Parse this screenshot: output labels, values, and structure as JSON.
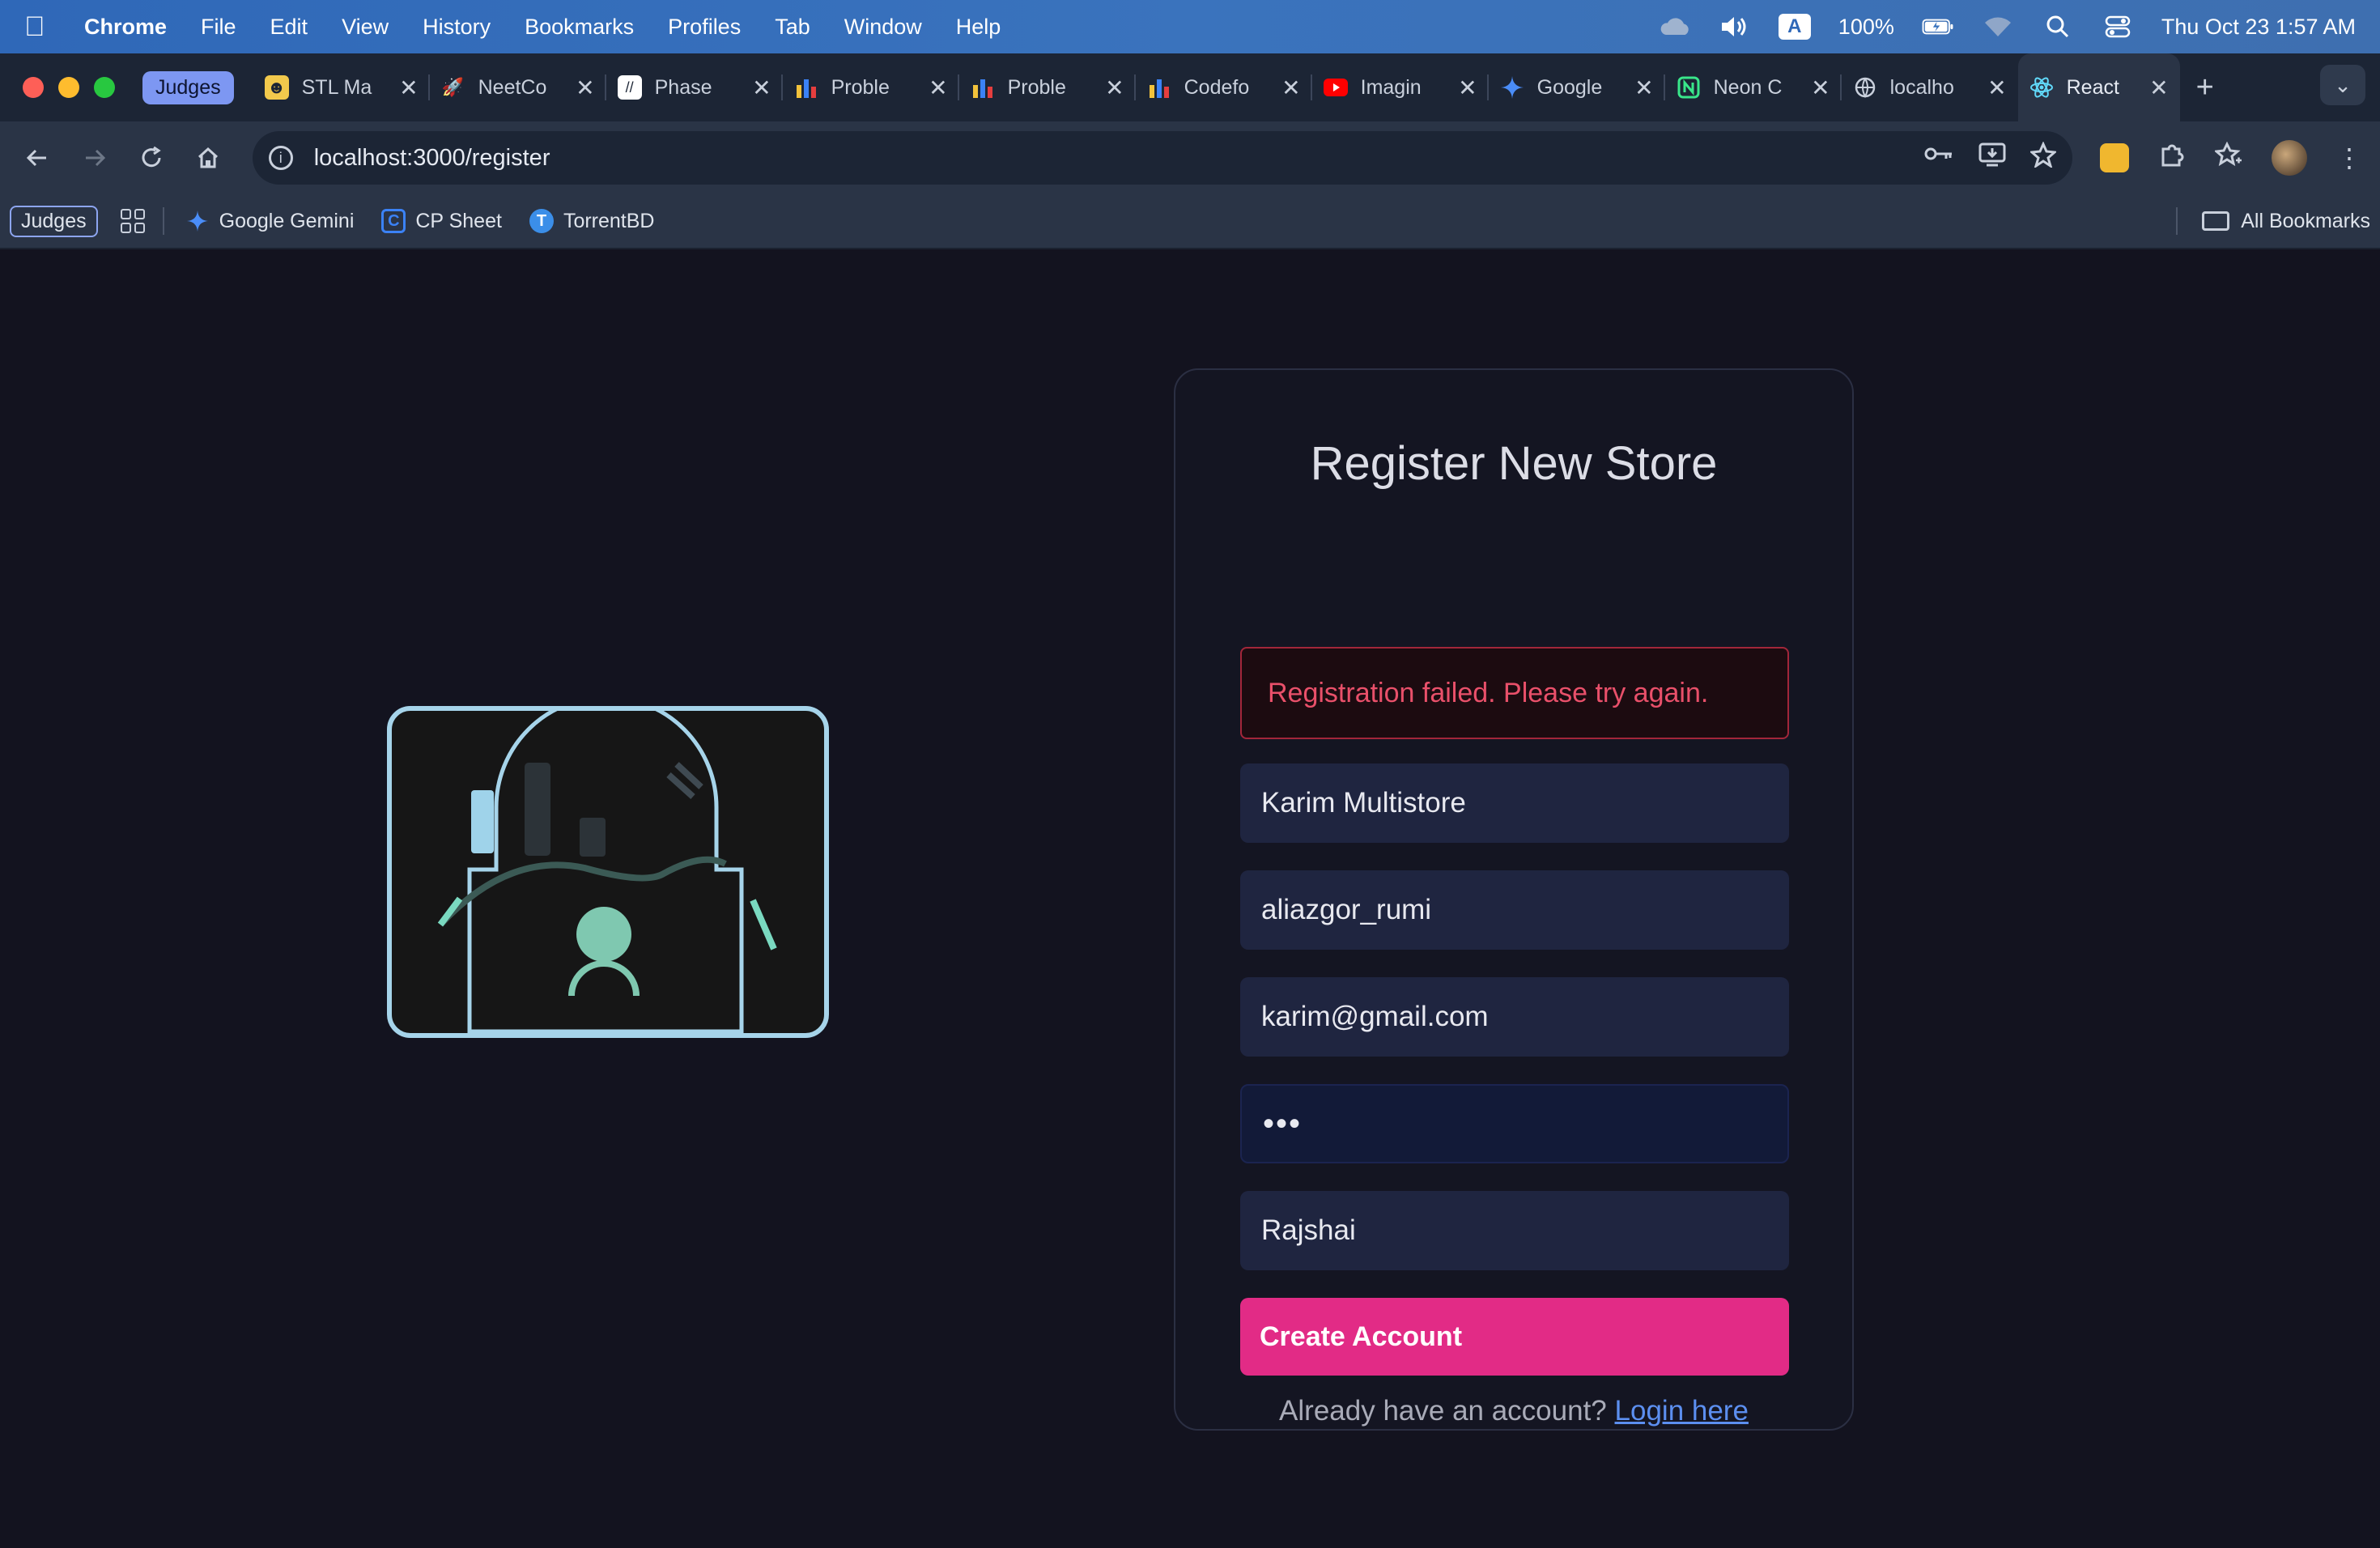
{
  "menubar": {
    "app_name": "Chrome",
    "items": [
      "File",
      "Edit",
      "View",
      "History",
      "Bookmarks",
      "Profiles",
      "Tab",
      "Window",
      "Help"
    ],
    "input_badge": "A",
    "battery": "100%",
    "clock": "Thu Oct 23  1:57 AM"
  },
  "tabstrip": {
    "group_label": "Judges",
    "tabs": [
      {
        "label": "STL Ma",
        "icon": "stl-icon",
        "color": "#f2c94c"
      },
      {
        "label": "NeetCo",
        "icon": "rocket-icon",
        "color": "#ff7a59"
      },
      {
        "label": "Phase",
        "icon": "phase-icon",
        "color": "#ffffff"
      },
      {
        "label": "Proble",
        "icon": "bar-chart-icon",
        "color": "#f2a93b"
      },
      {
        "label": "Proble",
        "icon": "bar-chart-icon",
        "color": "#f2a93b"
      },
      {
        "label": "Codefo",
        "icon": "bar-chart-icon",
        "color": "#f2a93b"
      },
      {
        "label": "Imagin",
        "icon": "youtube-icon",
        "color": "#ff0000"
      },
      {
        "label": "Google",
        "icon": "gemini-icon",
        "color": "#4a8df8"
      },
      {
        "label": "Neon C",
        "icon": "neon-icon",
        "color": "#39e68a"
      },
      {
        "label": "localho",
        "icon": "globe-icon",
        "color": "#c9d0dc"
      }
    ],
    "active_tab": {
      "label": "React A",
      "icon": "react-icon",
      "color": "#61dafb"
    }
  },
  "toolbar": {
    "url": "localhost:3000/register"
  },
  "bookmarks": {
    "group_label": "Judges",
    "items": [
      {
        "label": "Google Gemini",
        "icon": "gemini-icon"
      },
      {
        "label": "CP Sheet",
        "icon": "cp-sheet-icon"
      },
      {
        "label": "TorrentBD",
        "icon": "torrentbd-icon"
      }
    ],
    "all_label": "All Bookmarks"
  },
  "register": {
    "title": "Register New Store",
    "error": "Registration failed. Please try again.",
    "store_name": "Karim Multistore",
    "username": "aliazgor_rumi",
    "email": "karim@gmail.com",
    "password_mask": "•••",
    "location": "Rajshai",
    "submit_label": "Create Account",
    "login_prompt": "Already have an account?",
    "login_link": "Login here"
  },
  "colors": {
    "accent": "#e22b86",
    "error": "#e9506a",
    "link": "#5c8ff0",
    "background": "#13131f"
  }
}
